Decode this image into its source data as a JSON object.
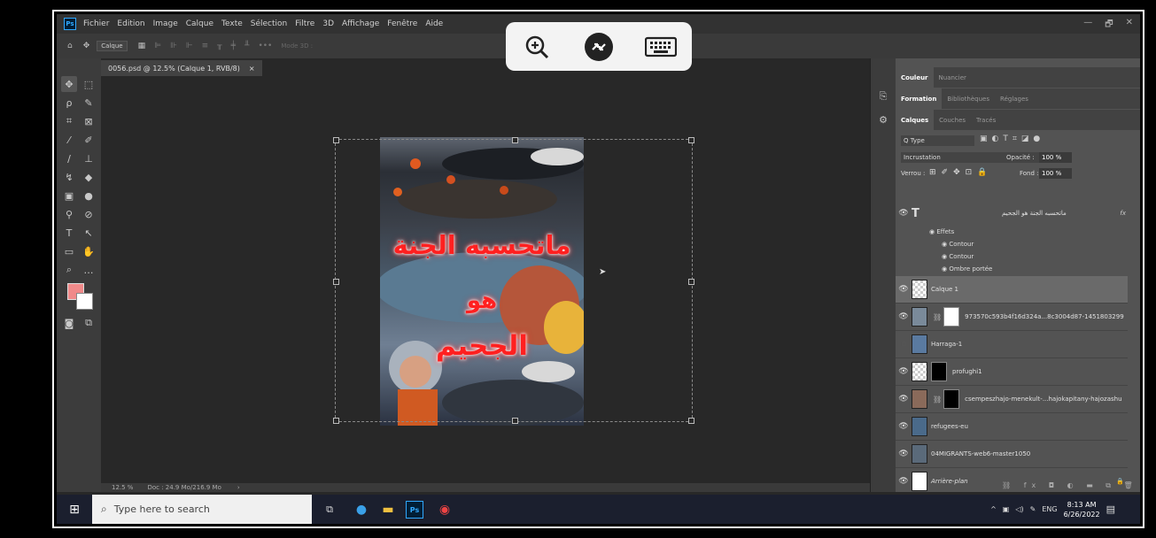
{
  "menubar": {
    "logo": "Ps",
    "items": [
      "Fichier",
      "Edition",
      "Image",
      "Calque",
      "Texte",
      "Sélection",
      "Filtre",
      "3D",
      "Affichage",
      "Fenêtre",
      "Aide"
    ],
    "controls": [
      "—",
      "🗗",
      "✕"
    ]
  },
  "options_bar": {
    "layer_select": "Calque",
    "mode3d": "Mode 3D :",
    "more": "•••"
  },
  "remote_toolbar": {
    "icons": [
      "zoom-in-icon",
      "connection-icon",
      "keyboard-icon"
    ]
  },
  "document": {
    "tab_title": "0056.psd @ 12.5% (Calque 1, RVB/8)",
    "tab_close": "×",
    "artwork_lines": [
      "ماتحسبه الجنة",
      "هو",
      "الجحيم"
    ]
  },
  "statusbar": {
    "zoom": "12.5 %",
    "doc_info": "Doc : 24.9 Mo/216.9 Mo",
    "arrow": "›"
  },
  "panels": {
    "tabs_row1": [
      "Couleur",
      "Nuancier"
    ],
    "tabs_row2": [
      "Formation",
      "Bibliothèques",
      "Réglages"
    ],
    "tabs_row3": [
      "Calques",
      "Couches",
      "Tracés"
    ],
    "filter_kind": "Q Type",
    "blend_mode": "Incrustation",
    "opacity_label": "Opacité :",
    "opacity_value": "100 %",
    "lock_label": "Verrou :",
    "fill_label": "Fond :",
    "fill_value": "100 %",
    "fx": "fx",
    "text_layer_name": "ماتحسبه الجنة هو الجحيم",
    "effects_label": "Effets",
    "effects": [
      "Contour",
      "Contour",
      "Ombre portée"
    ],
    "layers": [
      {
        "name": "Calque 1",
        "selected": true,
        "visible": true
      },
      {
        "name": "973570c593b4f16d324a...8c3004d87-1451803299",
        "visible": true
      },
      {
        "name": "Harraga-1",
        "visible": false
      },
      {
        "name": "profughi1",
        "visible": true
      },
      {
        "name": "csempeszhajo-menekult-...hajokapitany-hajozashu",
        "visible": true
      },
      {
        "name": "refugees-eu",
        "visible": true
      },
      {
        "name": "04MIGRANTS-web6-master1050",
        "visible": true
      },
      {
        "name": "Arrière-plan",
        "visible": true,
        "locked": true
      }
    ]
  },
  "taskbar": {
    "search_placeholder": "Type here to search",
    "language": "ENG",
    "time": "8:13 AM",
    "date": "6/26/2022"
  }
}
